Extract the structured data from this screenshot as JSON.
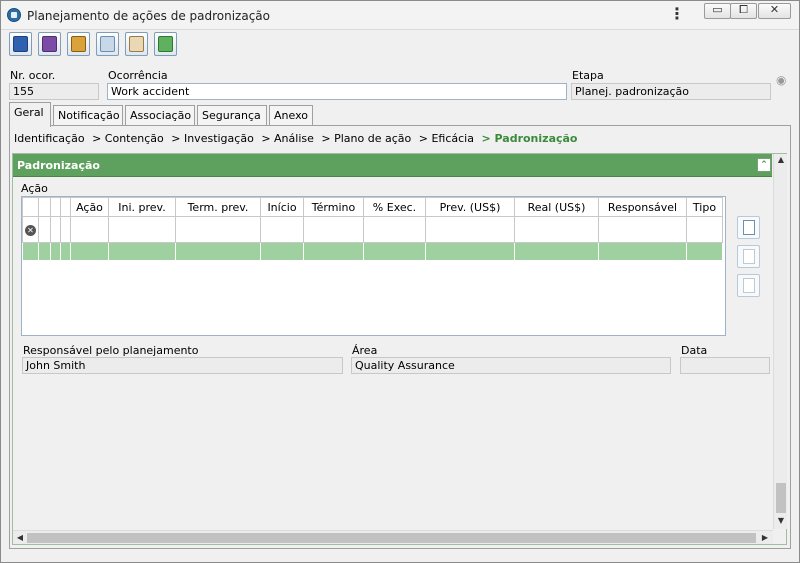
{
  "window": {
    "title": "Planejamento de ações de padronização"
  },
  "fields": {
    "nr_ocor_label": "Nr. ocor.",
    "nr_ocor_value": "155",
    "ocorrencia_label": "Ocorrência",
    "ocorrencia_value": "Work accident",
    "etapa_label": "Etapa",
    "etapa_value": "Planej. padronização"
  },
  "tabs": [
    "Geral",
    "Notificação",
    "Associação",
    "Segurança",
    "Anexo"
  ],
  "breadcrumb": [
    "Identificação",
    "> Contenção",
    "> Investigação",
    "> Análise",
    "> Plano de ação",
    "> Eficácia",
    "> Padronização"
  ],
  "section": {
    "title": "Padronização",
    "grid_label": "Ação",
    "columns": [
      "Ação",
      "Ini. prev.",
      "Term. prev.",
      "Início",
      "Término",
      "% Exec.",
      "Prev. (US$)",
      "Real (US$)",
      "Responsável",
      "Tipo"
    ]
  },
  "footer_fields": {
    "responsavel_label": "Responsável pelo planejamento",
    "responsavel_value": "John Smith",
    "area_label": "Área",
    "area_value": "Quality Assurance",
    "data_label": "Data",
    "data_value": ""
  },
  "colors": {
    "accent_green": "#5ea05e",
    "selected_row": "#9fd09f",
    "crumb_current": "#3a8a3a"
  },
  "icons": {
    "toolbar": [
      "save-icon",
      "save-close-icon",
      "gift-icon",
      "users-icon",
      "user-edit-icon",
      "refresh-icon"
    ],
    "side": [
      "new-document-icon",
      "refresh-icon",
      "delete-icon"
    ]
  }
}
